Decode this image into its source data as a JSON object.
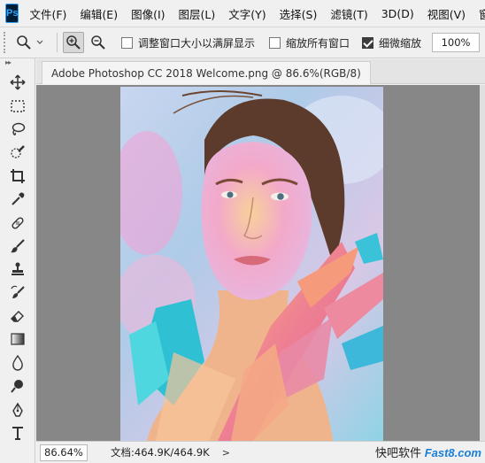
{
  "app": {
    "logo": "Ps"
  },
  "menu": [
    "文件(F)",
    "编辑(E)",
    "图像(I)",
    "图层(L)",
    "文字(Y)",
    "选择(S)",
    "滤镜(T)",
    "3D(D)",
    "视图(V)",
    "窗口"
  ],
  "options": {
    "checkbox_resize": "调整窗口大小以满屏显示",
    "checkbox_zoom_all": "缩放所有窗口",
    "checkbox_scrubby": "细微缩放",
    "zoom_value": "100%"
  },
  "document": {
    "tab_title": "Adobe Photoshop CC 2018 Welcome.png @ 86.6%(RGB/8)"
  },
  "status": {
    "zoom": "86.64%",
    "doc_info": "文档:464.9K/464.9K",
    "arrow": ">"
  },
  "watermark": {
    "left": "快吧软件",
    "brand": "Fast8.com"
  },
  "tools": [
    "move-icon",
    "marquee-icon",
    "lasso-icon",
    "quick-select-icon",
    "crop-icon",
    "eyedropper-icon",
    "healing-icon",
    "brush-icon",
    "stamp-icon",
    "history-brush-icon",
    "eraser-icon",
    "gradient-icon",
    "blur-icon",
    "dodge-icon",
    "pen-icon",
    "type-icon"
  ],
  "colors": {
    "ui_bg": "#f0f0f0",
    "canvas_bg": "#878787",
    "ps_blue": "#31a8ff"
  }
}
